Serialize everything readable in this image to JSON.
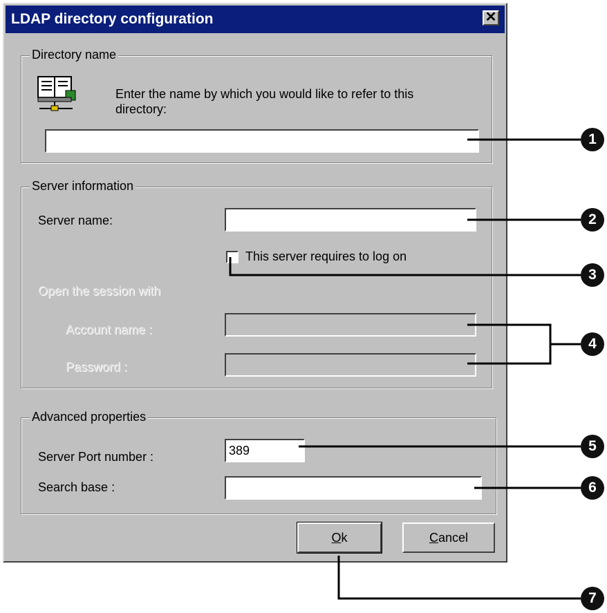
{
  "window": {
    "title": "LDAP directory configuration"
  },
  "directory_name": {
    "legend": "Directory name",
    "prompt": "Enter the name by which you would like to refer to this directory:",
    "icon": "directory-book-icon",
    "value": ""
  },
  "server_info": {
    "legend": "Server information",
    "server_name_label": "Server name:",
    "server_name_value": "",
    "logon_checkbox_label": "This server requires to log on",
    "logon_checked": false,
    "session_label": "Open the session with",
    "account_label": "Account name :",
    "account_value": "",
    "password_label": "Password :",
    "password_value": ""
  },
  "advanced": {
    "legend": "Advanced properties",
    "port_label": "Server Port number :",
    "port_value": "389",
    "search_base_label": "Search base :",
    "search_base_value": ""
  },
  "buttons": {
    "ok_mnemonic": "O",
    "ok_rest": "k",
    "cancel_mnemonic": "C",
    "cancel_rest": "ancel"
  },
  "callouts": [
    "1",
    "2",
    "3",
    "4",
    "5",
    "6",
    "7"
  ],
  "colors": {
    "titlebar": "#0a1e7a",
    "face": "#c0c0c0",
    "callout": "#111111"
  }
}
